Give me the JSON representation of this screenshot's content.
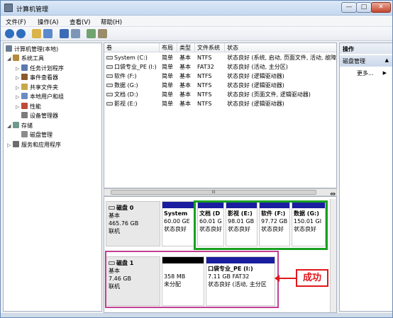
{
  "window": {
    "title": "计算机管理",
    "min": "—",
    "max": "□",
    "close": "✕"
  },
  "menu": [
    "文件(F)",
    "操作(A)",
    "查看(V)",
    "帮助(H)"
  ],
  "tree": {
    "root": "计算机管理(本地)",
    "items": [
      {
        "label": "系统工具",
        "level": 1,
        "arrow": "◢"
      },
      {
        "label": "任务计划程序",
        "level": 2,
        "arrow": "▷"
      },
      {
        "label": "事件查看器",
        "level": 2,
        "arrow": "▷"
      },
      {
        "label": "共享文件夹",
        "level": 2,
        "arrow": "▷"
      },
      {
        "label": "本地用户和组",
        "level": 2,
        "arrow": "▷"
      },
      {
        "label": "性能",
        "level": 2,
        "arrow": "▷"
      },
      {
        "label": "设备管理器",
        "level": 2,
        "arrow": ""
      },
      {
        "label": "存储",
        "level": 1,
        "arrow": "◢"
      },
      {
        "label": "磁盘管理",
        "level": 2,
        "arrow": ""
      },
      {
        "label": "服务和应用程序",
        "level": 1,
        "arrow": "▷"
      }
    ]
  },
  "volumes": {
    "headers": [
      "卷",
      "布局",
      "类型",
      "文件系统",
      "状态"
    ],
    "rows": [
      [
        "System (C:)",
        "简单",
        "基本",
        "NTFS",
        "状态良好 (系统, 启动, 页面文件, 活动, 故障"
      ],
      [
        "口袋专业_PE (I:)",
        "简单",
        "基本",
        "FAT32",
        "状态良好 (活动, 主分区)"
      ],
      [
        "软件 (F:)",
        "简单",
        "基本",
        "NTFS",
        "状态良好 (逻辑驱动器)"
      ],
      [
        "数据 (G:)",
        "简单",
        "基本",
        "NTFS",
        "状态良好 (逻辑驱动器)"
      ],
      [
        "文档 (D:)",
        "简单",
        "基本",
        "NTFS",
        "状态良好 (页面文件, 逻辑驱动器)"
      ],
      [
        "影视 (E:)",
        "简单",
        "基本",
        "NTFS",
        "状态良好 (逻辑驱动器)"
      ]
    ]
  },
  "scroll_center": "III",
  "disk0": {
    "name": "磁盘 0",
    "type": "基本",
    "size": "465.76 GB",
    "status": "联机",
    "partitions": [
      {
        "name": "System",
        "size": "60.00 GE",
        "status": "状态良好"
      },
      {
        "name": "文档 (D",
        "size": "60.01 G",
        "status": "状态良好"
      },
      {
        "name": "影视 (E:)",
        "size": "98.01 GB",
        "status": "状态良好"
      },
      {
        "name": "软件 (F:)",
        "size": "97.72 GB",
        "status": "状态良好"
      },
      {
        "name": "数据 (G:)",
        "size": "150.01 GI",
        "status": "状态良好"
      }
    ]
  },
  "disk1": {
    "name": "磁盘 1",
    "type": "基本",
    "size": "7.46 GB",
    "status": "联机",
    "unallocated": {
      "size": "358 MB",
      "status": "未分配"
    },
    "partition": {
      "name": "口袋专业_PE (I:)",
      "size": "7.11 GB FAT32",
      "status": "状态良好 (活动, 主分区"
    }
  },
  "actions": {
    "title": "操作",
    "section": "磁盘管理",
    "more": "更多..."
  },
  "callout": "成功",
  "colors": {
    "primary_partition": "#1a1d9f",
    "unallocated": "#000000",
    "success_outline": "#19a020",
    "disk_highlight": "#c23f93",
    "callout": "#e0171c"
  }
}
